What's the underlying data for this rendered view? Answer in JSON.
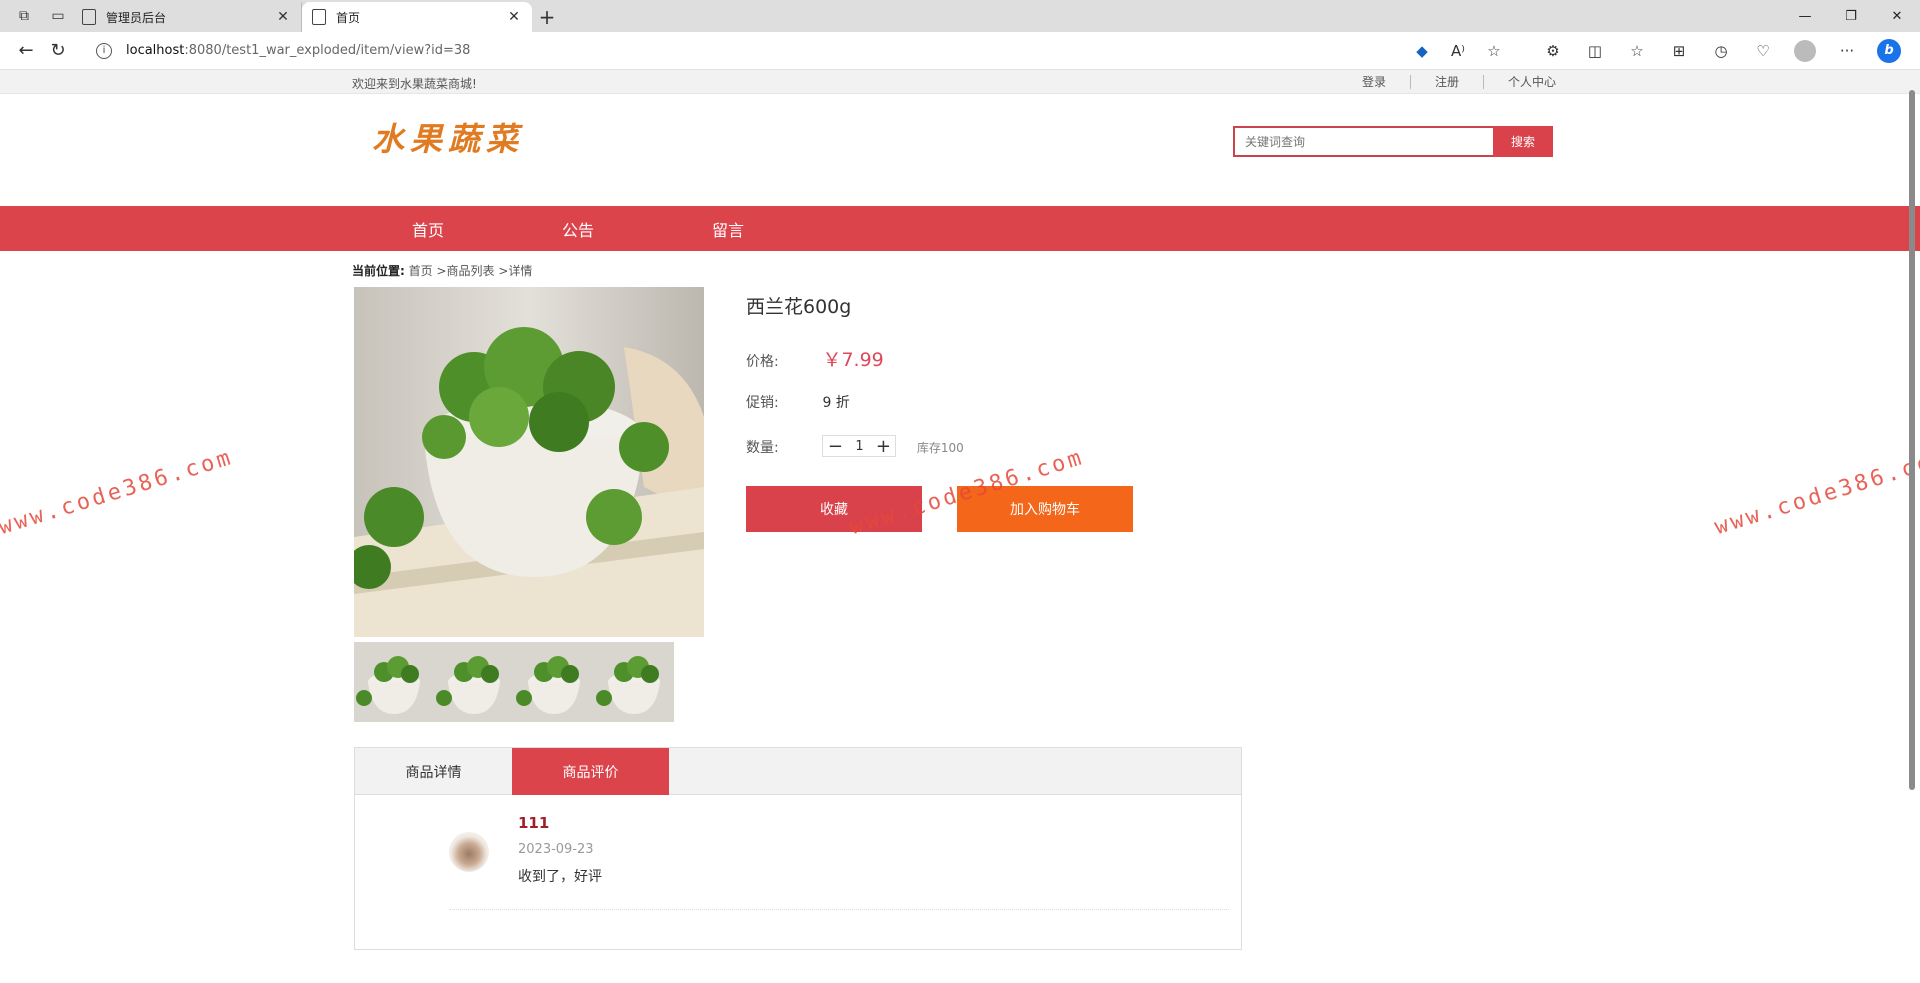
{
  "browser": {
    "tabs": [
      {
        "title": "管理员后台"
      },
      {
        "title": "首页"
      }
    ],
    "url_host": "localhost",
    "url_path": ":8080/test1_war_exploded/item/view?id=38"
  },
  "site": {
    "welcome": "欢迎来到水果蔬菜商城!",
    "toplinks": [
      "登录",
      "注册",
      "个人中心"
    ],
    "logo": "水果蔬菜",
    "search_placeholder": "关键词查询",
    "search_button": "搜索",
    "nav": [
      "首页",
      "公告",
      "留言"
    ]
  },
  "breadcrumb": {
    "label": "当前位置:",
    "path": "首页 >商品列表 >详情"
  },
  "product": {
    "name": "西兰花600g",
    "price_label": "价格:",
    "price": "￥7.99",
    "promo_label": "促销:",
    "promo_value": "9 折",
    "qty_label": "数量:",
    "qty_minus": "−",
    "qty_value": "1",
    "qty_plus": "+",
    "stock": "库存100",
    "fav_button": "收藏",
    "cart_button": "加入购物车"
  },
  "detail_tabs": [
    "商品详情",
    "商品评价"
  ],
  "review": {
    "user": "111",
    "date": "2023-09-23",
    "text": "收到了，好评"
  },
  "watermark": "www.code386.com"
}
